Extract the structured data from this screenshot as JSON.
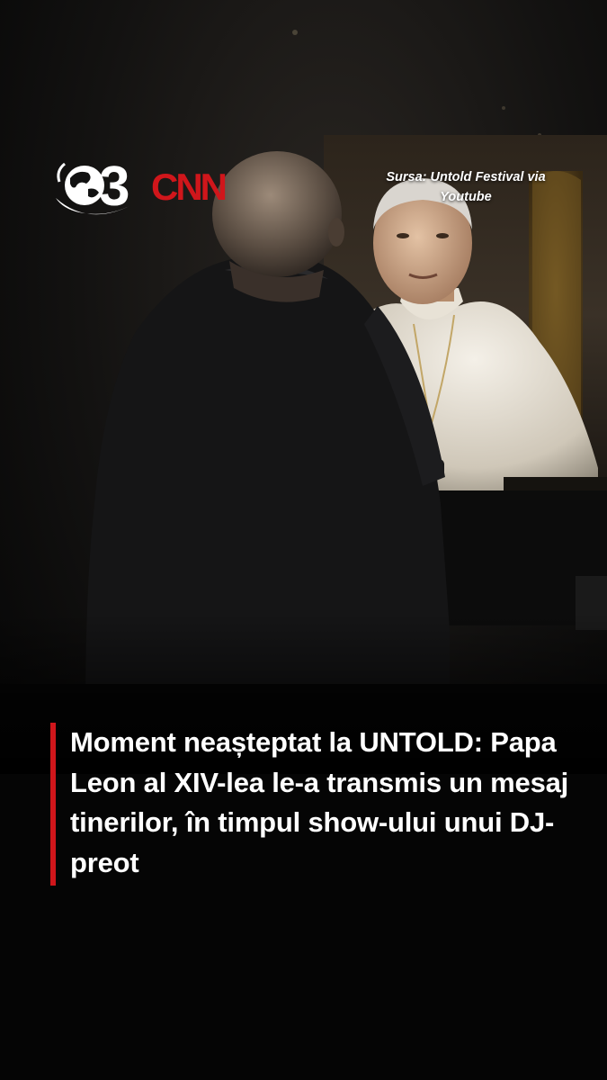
{
  "logo": {
    "channel_number": "3",
    "network_name": "CNN",
    "colors": {
      "channel": "#ffffff",
      "network": "#d0161b"
    }
  },
  "source_credit": "Sursa: Untold Festival via Youtube",
  "headline": "Moment neașteptat la UNTOLD: Papa Leon al XIV-lea le-a transmis un mesaj tinerilor, în timpul show-ului unui DJ-preot",
  "colors": {
    "accent": "#d0161b",
    "background": "#000000",
    "text": "#ffffff"
  }
}
